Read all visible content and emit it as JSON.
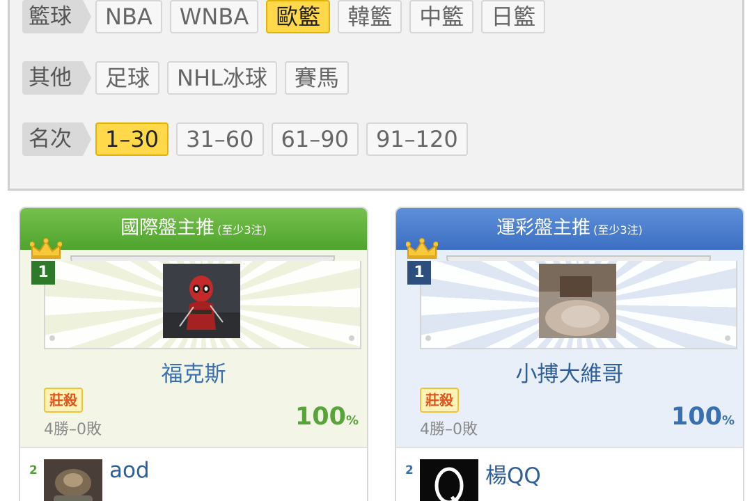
{
  "filters": {
    "rows": [
      {
        "label": "籃球",
        "chips": [
          "NBA",
          "WNBA",
          "歐籃",
          "韓籃",
          "中籃",
          "日籃"
        ],
        "active": 2
      },
      {
        "label": "其他",
        "chips": [
          "足球",
          "NHL冰球",
          "賽馬"
        ],
        "active": -1
      },
      {
        "label": "名次",
        "chips": [
          "1–30",
          "31–60",
          "61–90",
          "91–120"
        ],
        "active": 0
      }
    ]
  },
  "cards": [
    {
      "title": "國際盤主推",
      "subtitle": "(至少3注)",
      "rank": "1",
      "top_name": "福克斯",
      "tag": "莊殺",
      "record": "4勝–0敗",
      "pct_value": "100",
      "pct_unit": "%",
      "second": {
        "rank": "2",
        "name": "aod"
      }
    },
    {
      "title": "運彩盤主推",
      "subtitle": "(至少3注)",
      "rank": "1",
      "top_name": "小搏大維哥",
      "tag": "莊殺",
      "record": "4勝–0敗",
      "pct_value": "100",
      "pct_unit": "%",
      "second": {
        "rank": "2",
        "name": "楊QQ"
      }
    }
  ],
  "colors": {
    "active_chip": "#ffd94a",
    "green_header": "#4ea42c",
    "blue_header": "#3c6fc2",
    "tag_text": "#e2531c"
  }
}
